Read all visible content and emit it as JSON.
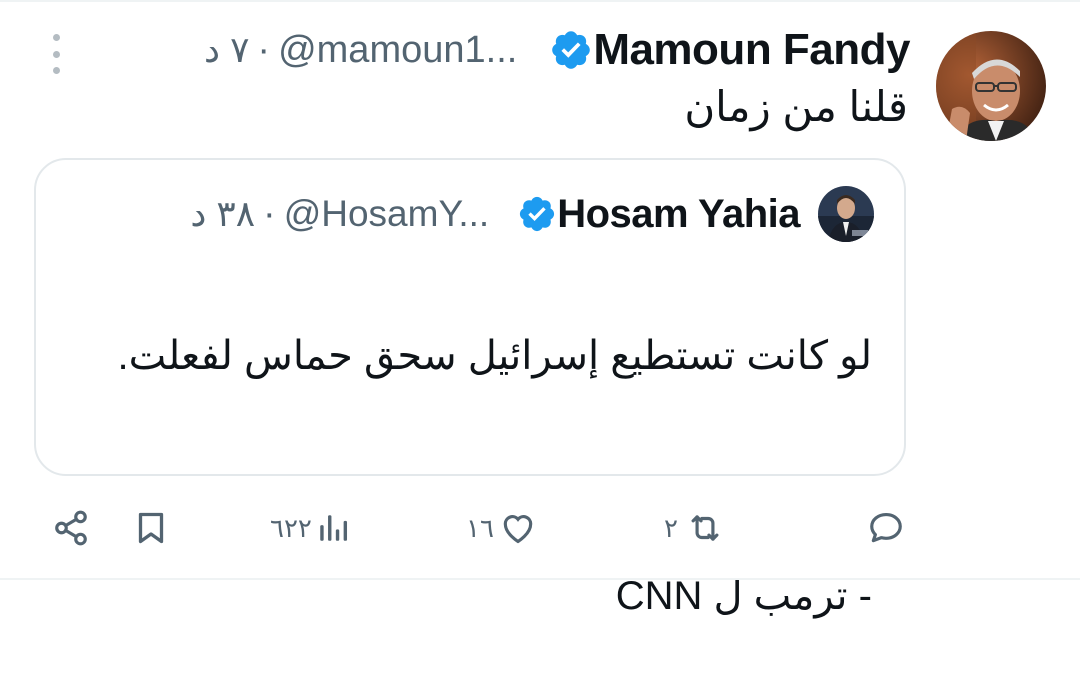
{
  "tweet": {
    "author_name": "Mamoun Fandy",
    "handle": "@mamoun1...",
    "separator": "·",
    "time": "٧ د",
    "text": "قلنا من زمان"
  },
  "quote": {
    "author_name": "Hosam Yahia",
    "handle": "@HosamY...",
    "separator": "·",
    "time": "٣٨ د",
    "text_line1": "لو كانت تستطيع إسرائيل سحق حماس لفعلت.",
    "text_line2": "- ترمب ل CNN"
  },
  "actions": {
    "retweets": "٢",
    "likes": "١٦",
    "views": "٦٢٢"
  },
  "colors": {
    "verified": "#1d9bf0",
    "secondary_text": "#536471",
    "primary_text": "#0f1419"
  },
  "icons": [
    "more-vertical-icon",
    "verified-icon",
    "reply-icon",
    "retweet-icon",
    "like-icon",
    "views-icon",
    "bookmark-icon",
    "share-icon"
  ]
}
